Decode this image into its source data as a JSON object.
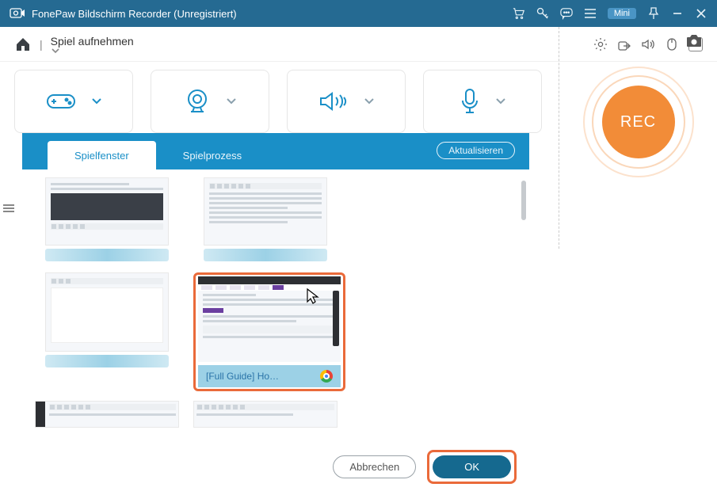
{
  "titlebar": {
    "title": "FonePaw Bildschirm Recorder (Unregistriert)",
    "mini": "Mini"
  },
  "modebar": {
    "mode": "Spiel aufnehmen"
  },
  "rec": {
    "label": "REC"
  },
  "popup": {
    "tabs": {
      "window": "Spielfenster",
      "process": "Spielprozess"
    },
    "refresh": "Aktualisieren",
    "selected_caption": "[Full Guide] Ho…",
    "cancel": "Abbrechen",
    "ok": "OK"
  }
}
